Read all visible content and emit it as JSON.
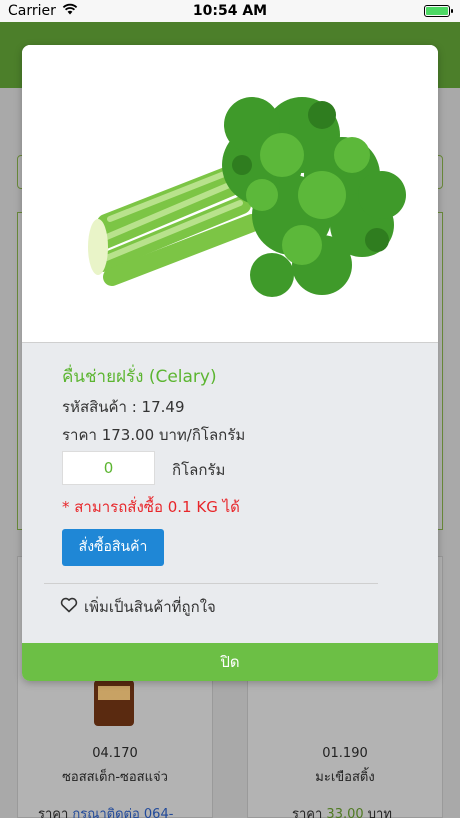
{
  "status_bar": {
    "carrier": "Carrier",
    "time": "10:54 AM",
    "battery_level": 1.0
  },
  "background": {
    "left_card": {
      "code": "04.170",
      "name": "ซอสสเต็ก-ซอสแจ่ว",
      "price_label": "ราคา",
      "price_value": "กรุณาติดต่อ 064-"
    },
    "right_card": {
      "code": "01.190",
      "name": "มะเขือสติ้ง",
      "price_label": "ราคา",
      "price_value": "33.00",
      "price_unit": "บาท"
    }
  },
  "modal": {
    "image_icon": "celery-image",
    "title": "คื่นช่ายฝรั่ง (Celary)",
    "code_line": "รหัสสินค้า : 17.49",
    "price_line": "ราคา 173.00 บาท/กิโลกรัม",
    "quantity_value": "0",
    "quantity_unit": "กิโลกรัม",
    "minimum_note": "* สามารถสั่งซื้อ 0.1 KG ได้",
    "order_button": "สั่งซื้อสินค้า",
    "favorite_label": "เพิ่มเป็นสินค้าที่ถูกใจ",
    "favorite_icon": "heart-outline-icon",
    "close_button": "ปิด"
  },
  "colors": {
    "accent_green": "#5cb531",
    "button_blue": "#1f87d6",
    "note_red": "#e8262a",
    "close_green": "#6cbf45"
  }
}
